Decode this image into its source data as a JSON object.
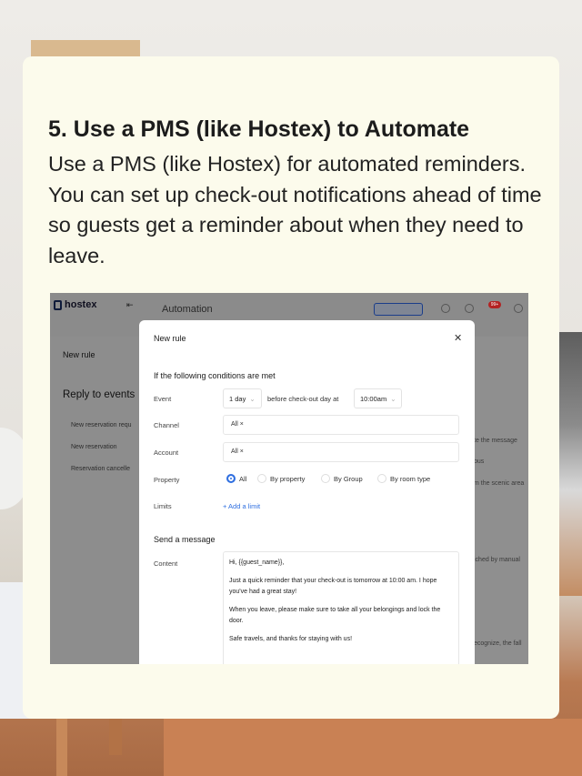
{
  "heading": {
    "title": "5. Use a PMS (like Hostex) to Automate",
    "body": "Use a PMS (like Hostex) for automated reminders. You can set up check-out notifications ahead of time so guests get a reminder about when they need to leave."
  },
  "app": {
    "logo": "hostex",
    "page_title": "Automation",
    "left": {
      "new_rule": "New rule",
      "section": "Reply to events",
      "items": [
        "New reservation requ",
        "New reservation",
        "Reservation cancelle"
      ]
    },
    "right_fragments": [
      "te the message",
      "bus",
      "m the scenic area",
      "iched by manual",
      "ecognize, the fall"
    ]
  },
  "modal": {
    "title": "New rule",
    "close_icon": "close-icon",
    "conditions_heading": "If the following conditions are met",
    "event": {
      "label": "Event",
      "days": "1 day",
      "connector": "before check-out day at",
      "time": "10:00am"
    },
    "channel": {
      "label": "Channel",
      "tag": "All ×"
    },
    "account": {
      "label": "Account",
      "tag": "All ×"
    },
    "property": {
      "label": "Property",
      "options": [
        "All",
        "By property",
        "By Group",
        "By room type"
      ],
      "selected": "All"
    },
    "limits": {
      "label": "Limits",
      "add": "+ Add a limit"
    },
    "send_heading": "Send a message",
    "content": {
      "label": "Content",
      "lines": [
        "Hi, {{guest_name}},",
        "Just a quick reminder that your check-out is tomorrow at 10:00 am. I hope you've had a great stay!",
        "When you leave, please make sure to take all your belongings and lock the door.",
        "Safe travels, and thanks for staying with us!"
      ]
    }
  },
  "colors": {
    "card": "#fcfbec",
    "accent": "#2f6fe0",
    "overlay": "#8f8f8f"
  }
}
